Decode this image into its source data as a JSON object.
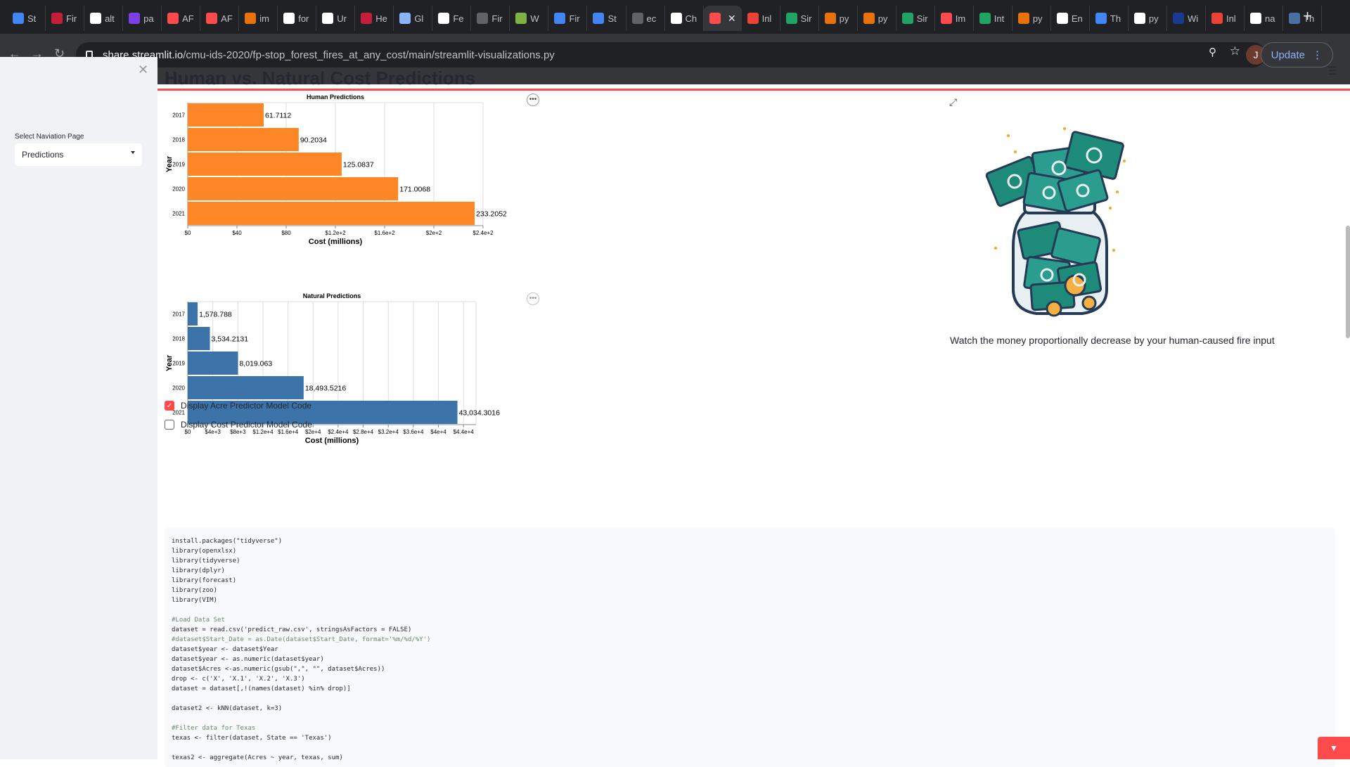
{
  "browser": {
    "tabs": [
      {
        "label": "St",
        "icon": "docs-icon",
        "color": "#4285f4"
      },
      {
        "label": "Fir",
        "icon": "c-icon",
        "color": "#c41e3a"
      },
      {
        "label": "alt",
        "icon": "google-icon",
        "color": "#ffffff"
      },
      {
        "label": "pa",
        "icon": "dot-icon",
        "color": "#7b3fe4"
      },
      {
        "label": "AF",
        "icon": "streamlit-icon",
        "color": "#ff4b4b"
      },
      {
        "label": "AF",
        "icon": "streamlit-icon",
        "color": "#ff4b4b"
      },
      {
        "label": "im",
        "icon": "wave-icon",
        "color": "#e8710a"
      },
      {
        "label": "for",
        "icon": "google-icon",
        "color": "#ffffff"
      },
      {
        "label": "Ur",
        "icon": "wikipedia-icon",
        "color": "#ffffff"
      },
      {
        "label": "He",
        "icon": "c-icon",
        "color": "#c41e3a"
      },
      {
        "label": "Gl",
        "icon": "globe-icon",
        "color": "#8ab4f8"
      },
      {
        "label": "Fe",
        "icon": "chrome-icon",
        "color": "#ffffff"
      },
      {
        "label": "Fir",
        "icon": "globe-icon",
        "color": "#5f6368"
      },
      {
        "label": "W",
        "icon": "w-icon",
        "color": "#7cb342"
      },
      {
        "label": "Fir",
        "icon": "docs-icon",
        "color": "#4285f4"
      },
      {
        "label": "St",
        "icon": "docs-icon",
        "color": "#4285f4"
      },
      {
        "label": "ec",
        "icon": "globe-icon",
        "color": "#5f6368"
      },
      {
        "label": "Ch",
        "icon": "github-icon",
        "color": "#ffffff"
      },
      {
        "label": "",
        "icon": "streamlit-icon",
        "color": "#ff4b4b",
        "active": true
      },
      {
        "label": "Inl",
        "icon": "gmail-icon",
        "color": "#ea4335"
      },
      {
        "label": "Sir",
        "icon": "drive-icon",
        "color": "#1fa463"
      },
      {
        "label": "py",
        "icon": "wave-icon",
        "color": "#e8710a"
      },
      {
        "label": "py",
        "icon": "wave-icon",
        "color": "#e8710a"
      },
      {
        "label": "Sir",
        "icon": "drive-icon",
        "color": "#1fa463"
      },
      {
        "label": "Im",
        "icon": "streamlit-icon",
        "color": "#ff4b4b"
      },
      {
        "label": "Int",
        "icon": "drive-icon",
        "color": "#1fa463"
      },
      {
        "label": "py",
        "icon": "wave-icon",
        "color": "#e8710a"
      },
      {
        "label": "En",
        "icon": "google-icon",
        "color": "#ffffff"
      },
      {
        "label": "Th",
        "icon": "drive-icon",
        "color": "#4285f4"
      },
      {
        "label": "py",
        "icon": "google-icon",
        "color": "#ffffff"
      },
      {
        "label": "Wi",
        "icon": "usn-icon",
        "color": "#1a3a8f"
      },
      {
        "label": "Inl",
        "icon": "gmail-icon",
        "color": "#ea4335"
      },
      {
        "label": "na",
        "icon": "r-icon",
        "color": "#ffffff"
      },
      {
        "label": "Th",
        "icon": "ids-icon",
        "color": "#4a6fa5"
      }
    ],
    "url_host": "share.streamlit.io",
    "url_path": "/cmu-ids-2020/fp-stop_forest_fires_at_any_cost/main/streamlit-visualizations.py",
    "avatar_letter": "J",
    "update_label": "Update"
  },
  "sidebar": {
    "select_label": "Select Naviation Page",
    "select_value": "Predictions"
  },
  "main": {
    "title": "Human vs. Natural Cost Predictions",
    "caption": "Watch the money proportionally decrease by your human-caused fire input",
    "checkbox_acre": "Display Acre Predictor Model Code",
    "checkbox_cost": "Display Cost Predictor Model Code",
    "code_lines": [
      "install.packages(\"tidyverse\")",
      "library(openxlsx)",
      "library(tidyverse)",
      "library(dplyr)",
      "library(forecast)",
      "library(zoo)",
      "library(VIM)",
      "",
      "#Load Data Set",
      "dataset = read.csv('predict_raw.csv', stringsAsFactors = FALSE)",
      "#dataset$Start_Date = as.Date(dataset$Start_Date, format='%m/%d/%Y')",
      "dataset$year <- dataset$Year",
      "dataset$year <- as.numeric(dataset$year)",
      "dataset$Acres <-as.numeric(gsub(\",\", \"\", dataset$Acres))",
      "drop <- c('X', 'X.1', 'X.2', 'X.3')",
      "dataset = dataset[,!(names(dataset) %in% drop)]",
      "",
      "dataset2 <- kNN(dataset, k=3)",
      "",
      "#Filter data for Texas",
      "texas <- filter(dataset, State == 'Texas')",
      "",
      "texas2 <- aggregate(Acres ~ year, texas, sum)"
    ]
  },
  "chart_data": [
    {
      "type": "bar",
      "orientation": "horizontal",
      "title": "Human Predictions",
      "xlabel": "Cost (millions)",
      "ylabel": "Year",
      "categories": [
        "2017",
        "2018",
        "2019",
        "2020",
        "2021"
      ],
      "values": [
        61.7112,
        90.2034,
        125.0837,
        171.0068,
        233.2052
      ],
      "value_labels": [
        "61.7112",
        "90.2034",
        "125.0837",
        "171.0068",
        "233.2052"
      ],
      "xlim": [
        0,
        240
      ],
      "x_ticks": [
        0,
        40,
        80,
        120,
        160,
        200,
        240
      ],
      "x_tick_labels": [
        "$0",
        "$40",
        "$80",
        "$1.2e+2",
        "$1.6e+2",
        "$2e+2",
        "$2.4e+2"
      ],
      "color": "#fd8727",
      "grid": true
    },
    {
      "type": "bar",
      "orientation": "horizontal",
      "title": "Natural Predictions",
      "xlabel": "Cost (millions)",
      "ylabel": "Year",
      "categories": [
        "2017",
        "2018",
        "2019",
        "2020",
        "2021"
      ],
      "values": [
        1578.788,
        3534.2131,
        8019.063,
        18493.5216,
        43034.3016
      ],
      "value_labels": [
        "1,578.788",
        "3,534.2131",
        "8,019.063",
        "18,493.5216",
        "43,034.3016"
      ],
      "xlim": [
        0,
        46000
      ],
      "x_ticks": [
        0,
        4000,
        8000,
        12000,
        16000,
        20000,
        24000,
        28000,
        32000,
        36000,
        40000,
        44000
      ],
      "x_tick_labels": [
        "$0",
        "$4e+3",
        "$8e+3",
        "$1.2e+4",
        "$1.6e+4",
        "$2e+4",
        "$2.4e+4",
        "$2.8e+4",
        "$3.2e+4",
        "$3.6e+4",
        "$4e+4",
        "$4.4e+4"
      ],
      "color": "#3b72a8",
      "grid": true
    }
  ]
}
